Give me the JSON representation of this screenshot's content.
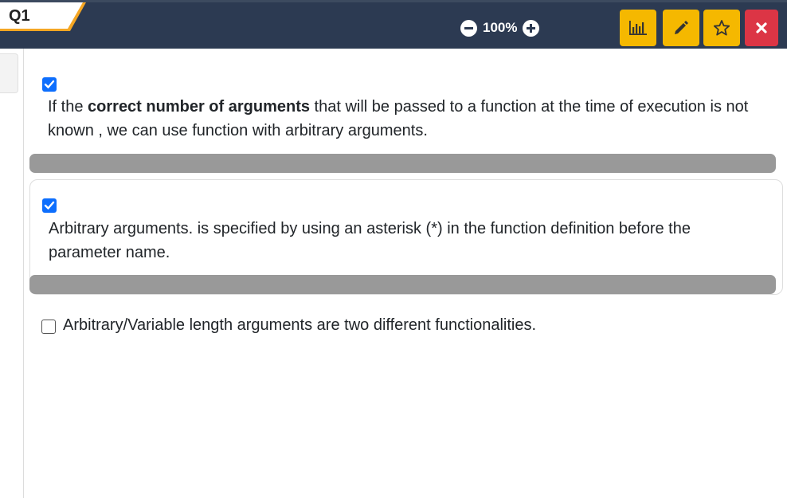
{
  "question": {
    "label": "Q1",
    "zoom": "100%"
  },
  "toolbar": {
    "stats_icon": "bar-chart-icon",
    "edit_icon": "pencil-icon",
    "star_icon": "star-icon",
    "close_icon": "close-icon"
  },
  "colors": {
    "header_bg": "#2c3a52",
    "tool_yellow": "#f5b800",
    "close_red": "#dc3545",
    "checkbox_blue": "#0d6efd",
    "tab_accent": "#f5a623"
  },
  "options": [
    {
      "checked": true,
      "text_before": "If the ",
      "text_bold": "correct number of arguments",
      "text_after": " that will be passed to a function at the time of execution is not known , we can use function with arbitrary arguments."
    },
    {
      "checked": true,
      "text": "Arbitrary arguments. is specified by using an asterisk (*) in the function definition before the parameter name."
    },
    {
      "checked": false,
      "text": "Arbitrary/Variable length arguments are two different functionalities."
    }
  ]
}
